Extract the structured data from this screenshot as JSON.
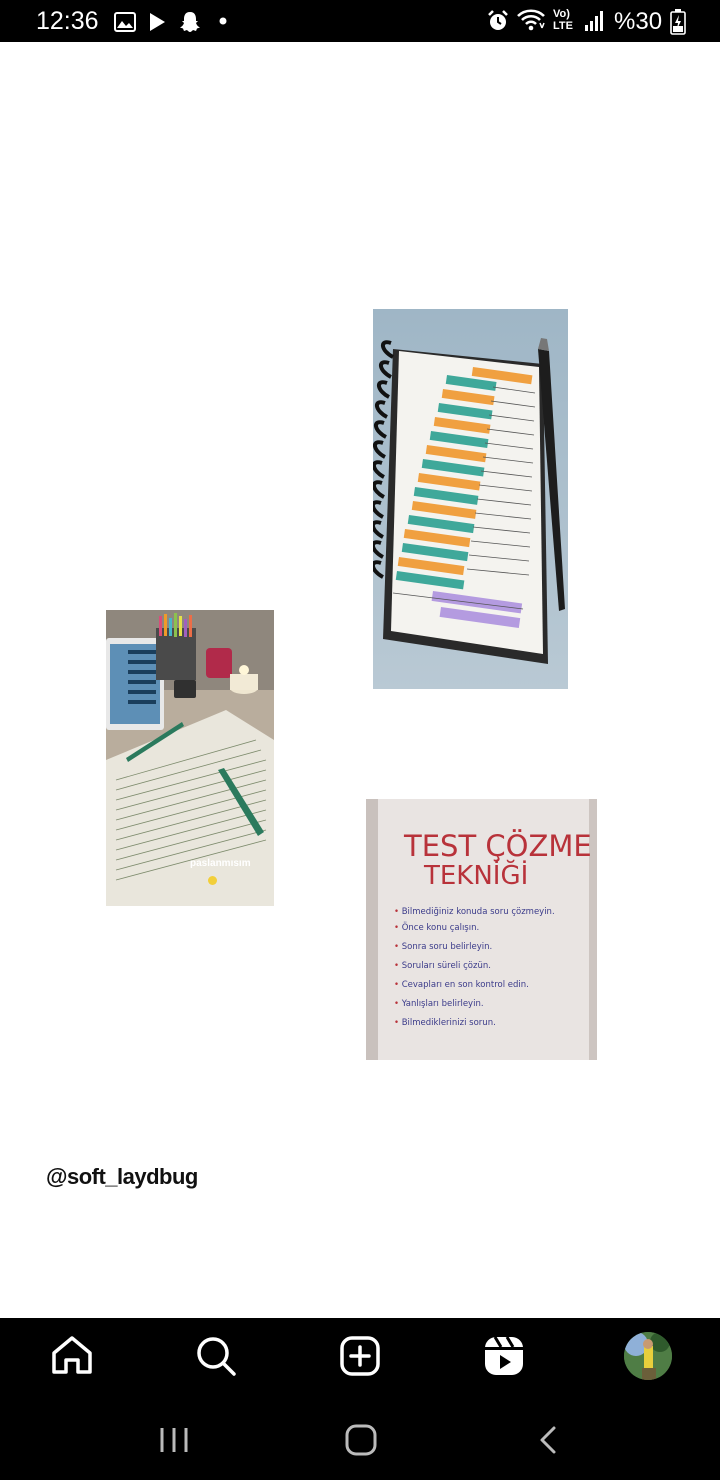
{
  "status_bar": {
    "time": "12:36",
    "lte_top": "Vo)",
    "lte_bottom": "LTE",
    "battery_text": "%30",
    "left_icons": [
      "gallery-icon",
      "play-icon",
      "snapchat-icon",
      "dot-icon"
    ],
    "right_icons": [
      "alarm-icon",
      "wifi-icon",
      "signal-icon",
      "battery-icon"
    ]
  },
  "story": {
    "username_watermark": "@soft_laydbug",
    "desk_photo_caption": "paslanmısım",
    "card": {
      "title_line1": "TEST ÇÖZME",
      "title_line2": "TEKNİĞİ",
      "items": [
        "Bilmediğiniz konuda soru çözmeyin.",
        "Önce konu çalışın.",
        "Sonra soru belirleyin.",
        "Soruları süreli çözün.",
        "Cevapları en son kontrol edin.",
        "Yanlışları belirleyin.",
        "Bilmediklerinizi sorun."
      ]
    }
  },
  "tab_bar": {
    "items": [
      "home-icon",
      "search-icon",
      "create-icon",
      "reels-icon",
      "profile-avatar"
    ]
  },
  "nav_bar": {
    "items": [
      "recent-apps-icon",
      "home-nav-icon",
      "back-icon"
    ]
  },
  "colors": {
    "highlight_orange": "#f0a040",
    "highlight_teal": "#3fa89a",
    "highlight_purple": "#b49be0",
    "card_red": "#b8323a"
  }
}
